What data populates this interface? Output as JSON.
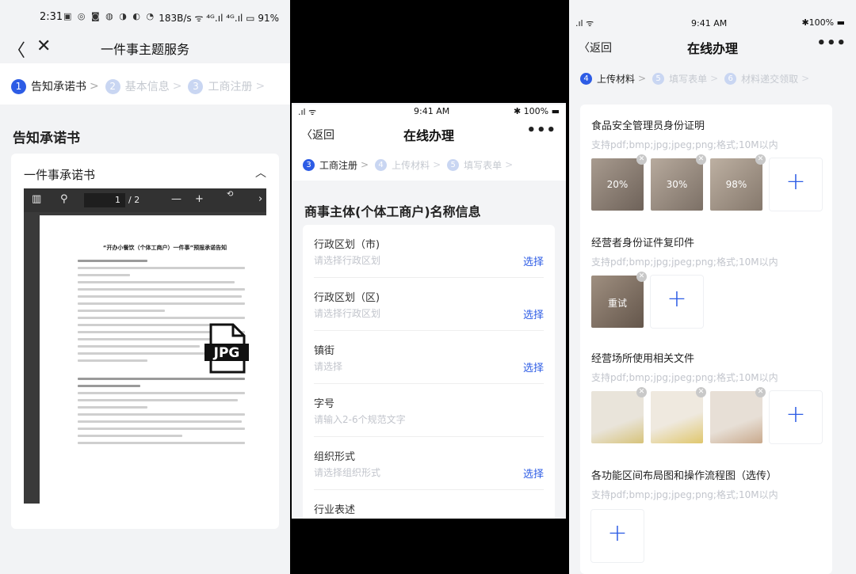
{
  "panel1": {
    "status": {
      "time": "2:31",
      "icons": "▣ ◎ ◙ ◍ ◑ ◐ ◔",
      "right": "183B/s ᯤ ⁴ᴳ.ıl ⁴ᴳ.ıl ▭ 91%"
    },
    "header": {
      "back": "〈",
      "close": "✕",
      "title": "一件事主题服务"
    },
    "steps": [
      {
        "num": "1",
        "label": "告知承诺书"
      },
      {
        "num": "2",
        "label": "基本信息"
      },
      {
        "num": "3",
        "label": "工商注册"
      }
    ],
    "section_title": "告知承诺书",
    "card_title": "一件事承诺书",
    "pdf": {
      "page_current": "1",
      "page_total": "/ 2",
      "doc_title": "“开办小餐饮（个体工商户）一件事”预报承诺告知"
    },
    "jpg_badge": "JPG"
  },
  "panel2": {
    "status": {
      "time": "9:41 AM",
      "left": ".ıl ᯤ",
      "right": "✱ 100% ▬"
    },
    "nav": {
      "back": "〈返回",
      "title": "在线办理",
      "more": "•••"
    },
    "steps": [
      {
        "num": "3",
        "label": "工商注册"
      },
      {
        "num": "4",
        "label": "上传材料"
      },
      {
        "num": "5",
        "label": "填写表单"
      }
    ],
    "section_title": "商事主体(个体工商户)名称信息",
    "fields": [
      {
        "label": "行政区划（市)",
        "placeholder": "请选择行政区划",
        "action": "选择"
      },
      {
        "label": "行政区划（区)",
        "placeholder": "请选择行政区划",
        "action": "选择"
      },
      {
        "label": "镇街",
        "placeholder": "请选择",
        "action": "选择"
      },
      {
        "label": "字号",
        "placeholder": "请输入2-6个规范文字",
        "action": ""
      },
      {
        "label": "组织形式",
        "placeholder": "请选择组织形式",
        "action": "选择"
      },
      {
        "label": "行业表述",
        "placeholder": "",
        "action": ""
      }
    ]
  },
  "panel3": {
    "status": {
      "time": "9:41 AM",
      "left": ".ıl ᯤ",
      "right": "✱100% ▬"
    },
    "nav": {
      "back": "〈返回",
      "title": "在线办理",
      "more": "•••"
    },
    "steps": [
      {
        "num": "4",
        "label": "上传材料"
      },
      {
        "num": "5",
        "label": "填写表单"
      },
      {
        "num": "6",
        "label": "材料递交领取"
      }
    ],
    "uploads": [
      {
        "title": "食品安全管理员身份证明",
        "hint": "支持pdf;bmp;jpg;jpeg;png;格式;10M以内",
        "thumbs": [
          "20%",
          "30%",
          "98%"
        ]
      },
      {
        "title": "经营者身份证件复印件",
        "hint": "支持pdf;bmp;jpg;jpeg;png;格式;10M以内",
        "thumbs": [
          "重试"
        ]
      },
      {
        "title": "经营场所使用相关文件",
        "hint": "支持pdf;bmp;jpg;jpeg;png;格式;10M以内",
        "thumbs": [
          "",
          "",
          ""
        ]
      },
      {
        "title": "各功能区间布局图和操作流程图（选传）",
        "hint": "支持pdf;bmp;jpg;jpeg;png;格式;10M以内",
        "thumbs": []
      }
    ],
    "add_symbol": "+",
    "remove_symbol": "✕"
  }
}
